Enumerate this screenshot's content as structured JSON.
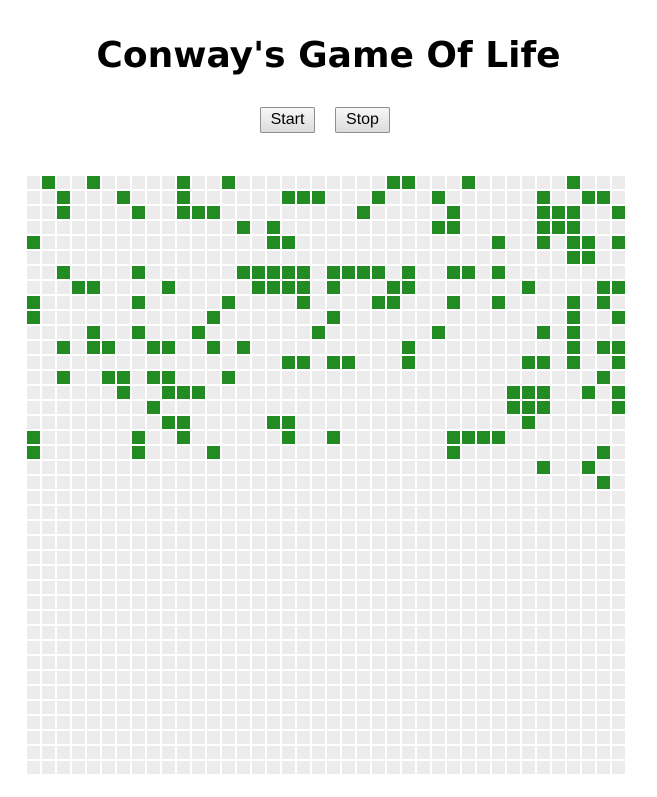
{
  "title": "Conway's Game Of Life",
  "controls": {
    "start_label": "Start",
    "stop_label": "Stop"
  },
  "colors": {
    "alive": "#228b22",
    "dead": "#ececec",
    "grid_line": "#ffffff"
  },
  "board": {
    "rows": 40,
    "cols": 40,
    "cells": [
      "0100100000100100000000001100010000001000",
      "0010001000100000011100010001000000100110",
      "0010000100111000000000100000100000111001",
      "0000000000000010100000000001100000111000",
      "1000000000000000110000000000000100101101",
      "0000000000000000000000000000000000001100",
      "0010000100000011111011110100110100000000",
      "0001100001000001111010001100000001000011",
      "1000000100000100001000011000100100001010",
      "1000000000001000000010000000000000001001",
      "0000100100010000000100000001000000101000",
      "0010110011001010000000000100000000001011",
      "0000000000000000011011000100000001101001",
      "0010011011000100000000000000000000000010",
      "0000001001110000000000000000000011100101",
      "0000000010000000000000000000000011100001",
      "0000000001100000110000000000000001000000",
      "1000000100100000010010000000111100000000",
      "1000000100001000000000000000100000000010",
      "0000000000000000000000000000000000100100",
      "0000000000000000000000000000000000000010",
      "0000000000000000000000000000000000000000",
      "0000000000000000000000000000000000000000",
      "0000000000000000000000000000000000000000",
      "0000000000000000000000000000000000000000",
      "0000000000000000000000000000000000000000",
      "0000000000000000000000000000000000000000",
      "0000000000000000000000000000000000000000",
      "0000000000000000000000000000000000000000",
      "0000000000000000000000000000000000000000",
      "0000000000000000000000000000000000000000",
      "0000000000000000000000000000000000000000",
      "0000000000000000000000000000000000000000",
      "0000000000000000000000000000000000000000",
      "0000000000000000000000000000000000000000",
      "0000000000000000000000000000000000000000",
      "0000000000000000000000000000000000000000",
      "0000000000000000000000000000000000000000",
      "0000000000000000000000000000000000000000",
      "0000000000000000000000000000000000000000"
    ]
  }
}
